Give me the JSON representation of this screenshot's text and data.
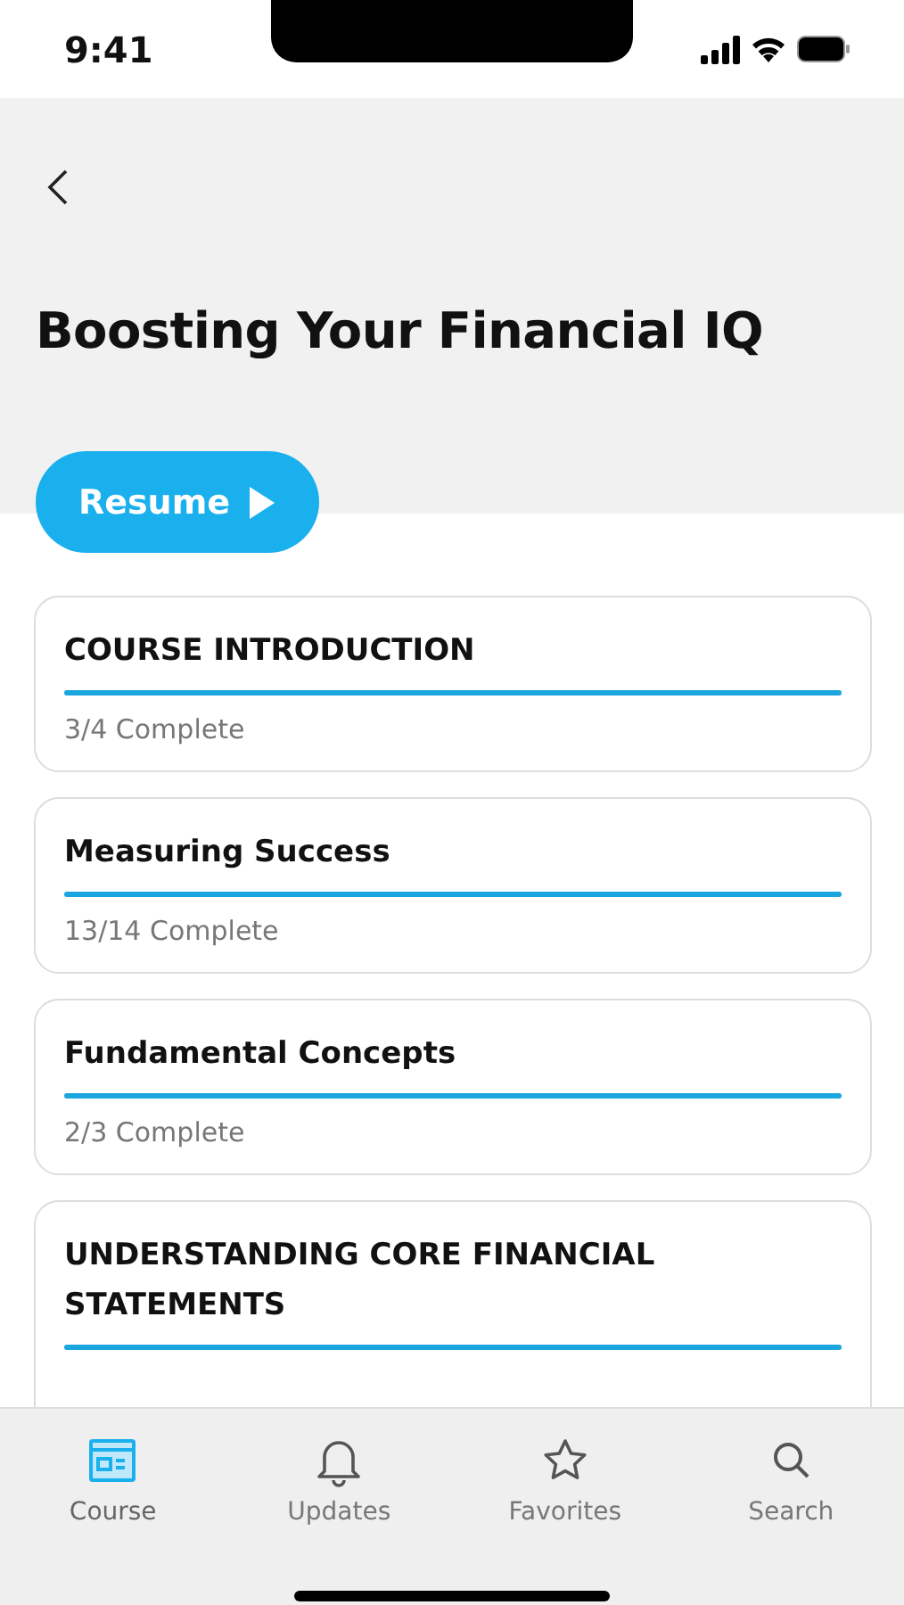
{
  "status_bar": {
    "time": "9:41"
  },
  "title": "Boosting Your Financial IQ",
  "resume_button": {
    "label": "Resume"
  },
  "modules": [
    {
      "title": "COURSE INTRODUCTION",
      "level": 1,
      "progress": "3/4 Complete"
    },
    {
      "title": "Measuring Success",
      "level": 1,
      "progress": "13/14 Complete"
    },
    {
      "title": "Fundamental Concepts",
      "level": 1,
      "progress": "2/3 Complete"
    },
    {
      "title": "UNDERSTANDING CORE FINANCIAL STATEMENTS",
      "level": 1
    }
  ],
  "tabs": [
    {
      "label": "Course",
      "kind": "course",
      "selected": true
    },
    {
      "label": "Updates",
      "kind": "bell",
      "selected": false
    },
    {
      "label": "Favorites",
      "kind": "star",
      "selected": false
    },
    {
      "label": "Search",
      "kind": "search",
      "selected": false
    }
  ]
}
